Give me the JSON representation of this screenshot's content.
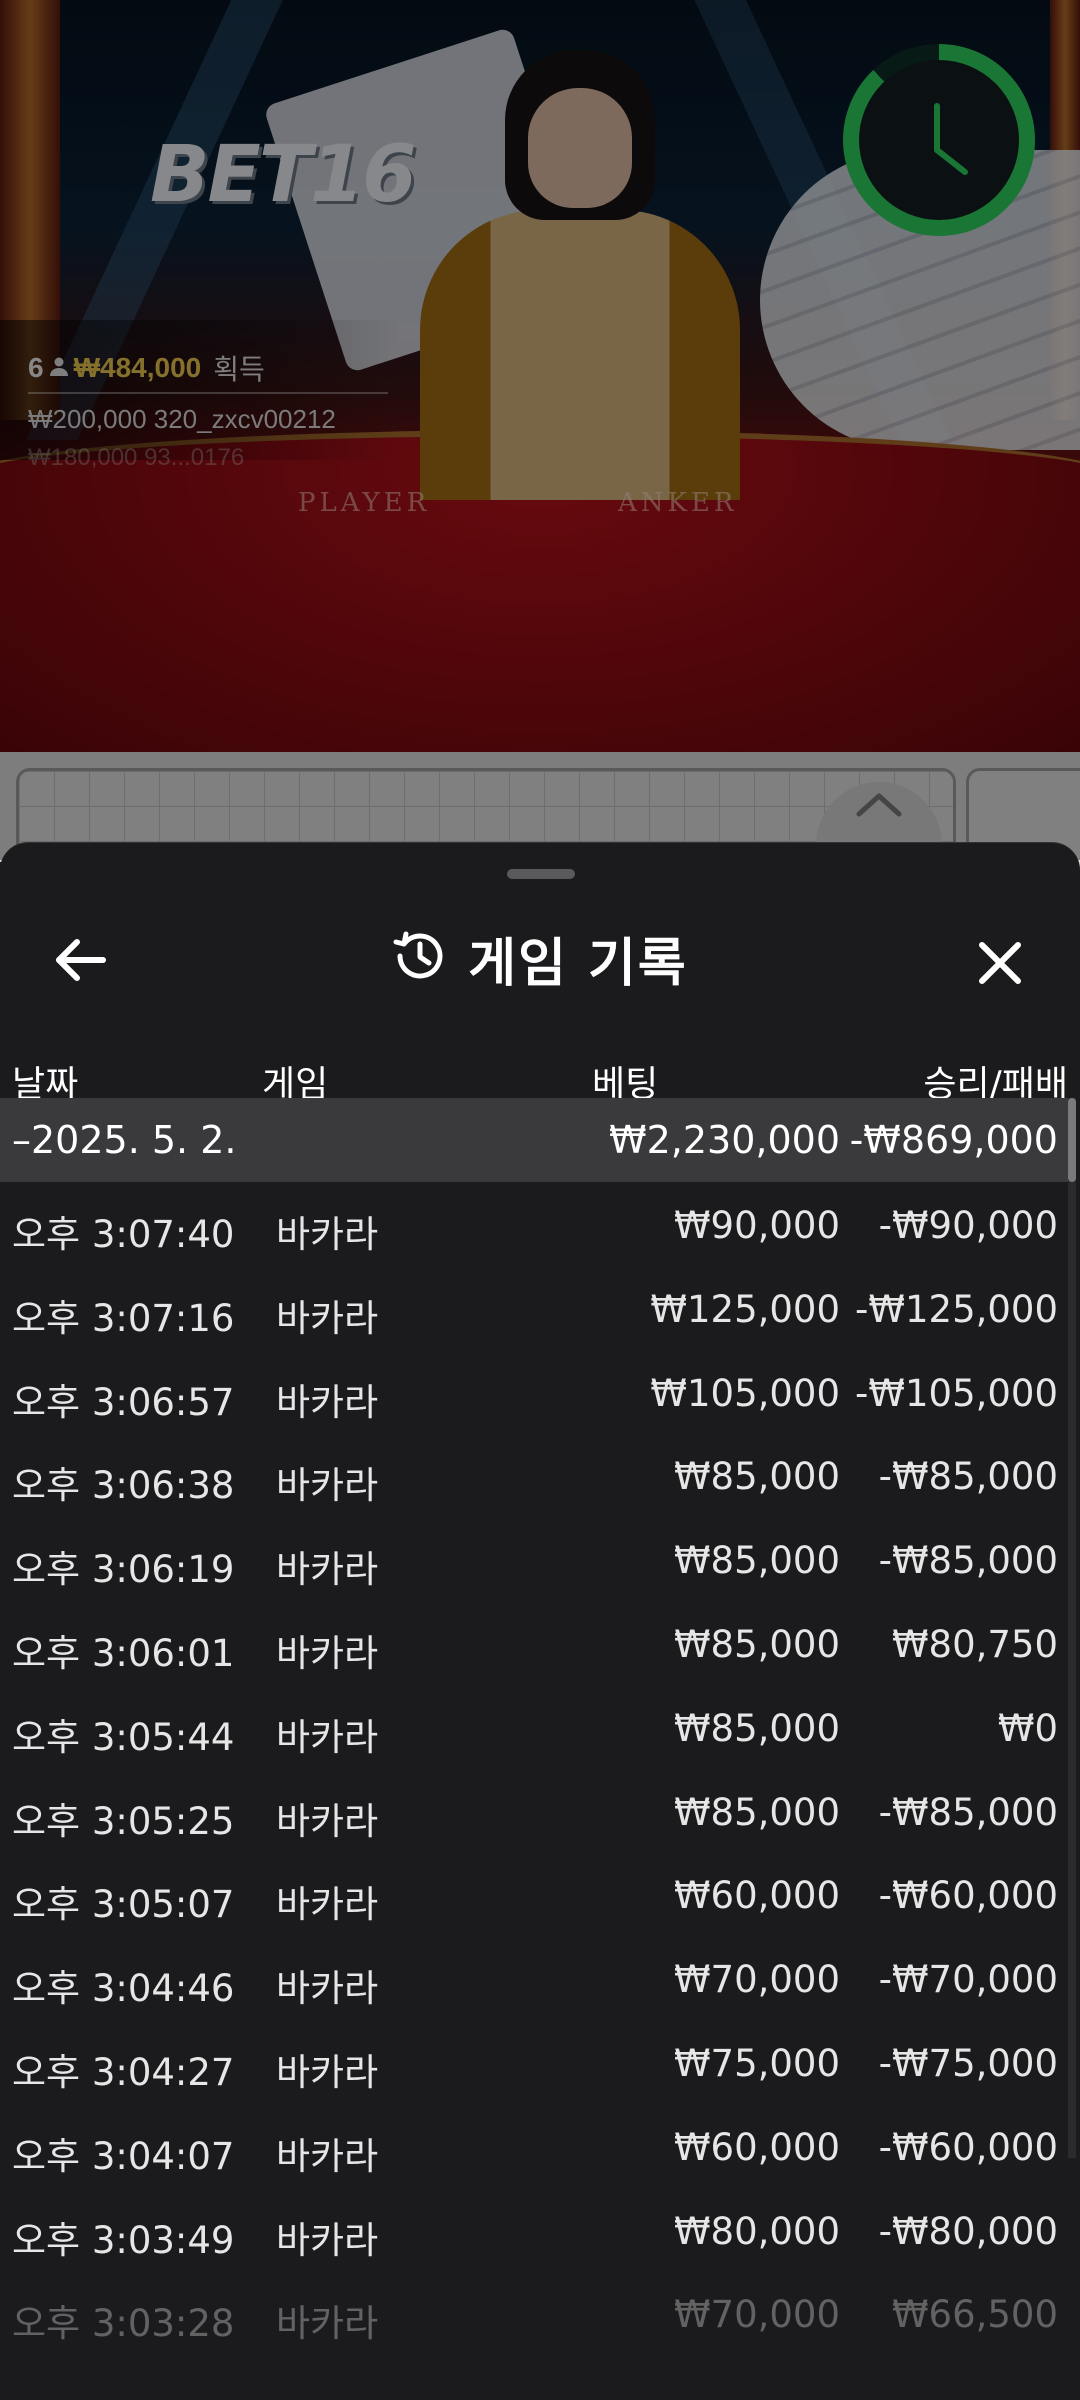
{
  "stream": {
    "logo": "BET16",
    "table_labels": {
      "player": "PLAYER",
      "banker": "ANKER"
    },
    "chat": {
      "count": "6",
      "amount": "₩484,000",
      "win_label": "획득",
      "line2": "₩200,000  320_zxcv00212",
      "line3": "₩180,000  93...0176"
    },
    "timer_icon": "clock-icon",
    "timer_color": "#2ecc5c"
  },
  "sheet": {
    "title": "게임 기록",
    "title_icon": "history-icon",
    "back_icon": "arrow-left-icon",
    "close_icon": "close-icon",
    "columns": [
      "날짜",
      "게임",
      "베팅",
      "승리/패배"
    ],
    "group": {
      "date": "–2025. 5. 2.",
      "bet": "₩2,230,000",
      "result": "-₩869,000"
    },
    "rows": [
      {
        "time": "오후 3:07:40",
        "game": "바카라",
        "bet": "₩90,000",
        "result": "-₩90,000"
      },
      {
        "time": "오후 3:07:16",
        "game": "바카라",
        "bet": "₩125,000",
        "result": "-₩125,000"
      },
      {
        "time": "오후 3:06:57",
        "game": "바카라",
        "bet": "₩105,000",
        "result": "-₩105,000"
      },
      {
        "time": "오후 3:06:38",
        "game": "바카라",
        "bet": "₩85,000",
        "result": "-₩85,000"
      },
      {
        "time": "오후 3:06:19",
        "game": "바카라",
        "bet": "₩85,000",
        "result": "-₩85,000"
      },
      {
        "time": "오후 3:06:01",
        "game": "바카라",
        "bet": "₩85,000",
        "result": "₩80,750"
      },
      {
        "time": "오후 3:05:44",
        "game": "바카라",
        "bet": "₩85,000",
        "result": "₩0"
      },
      {
        "time": "오후 3:05:25",
        "game": "바카라",
        "bet": "₩85,000",
        "result": "-₩85,000"
      },
      {
        "time": "오후 3:05:07",
        "game": "바카라",
        "bet": "₩60,000",
        "result": "-₩60,000"
      },
      {
        "time": "오후 3:04:46",
        "game": "바카라",
        "bet": "₩70,000",
        "result": "-₩70,000"
      },
      {
        "time": "오후 3:04:27",
        "game": "바카라",
        "bet": "₩75,000",
        "result": "-₩75,000"
      },
      {
        "time": "오후 3:04:07",
        "game": "바카라",
        "bet": "₩60,000",
        "result": "-₩60,000"
      },
      {
        "time": "오후 3:03:49",
        "game": "바카라",
        "bet": "₩80,000",
        "result": "-₩80,000"
      },
      {
        "time": "오후 3:03:28",
        "game": "바카라",
        "bet": "₩70,000",
        "result": "₩66,500"
      }
    ]
  }
}
